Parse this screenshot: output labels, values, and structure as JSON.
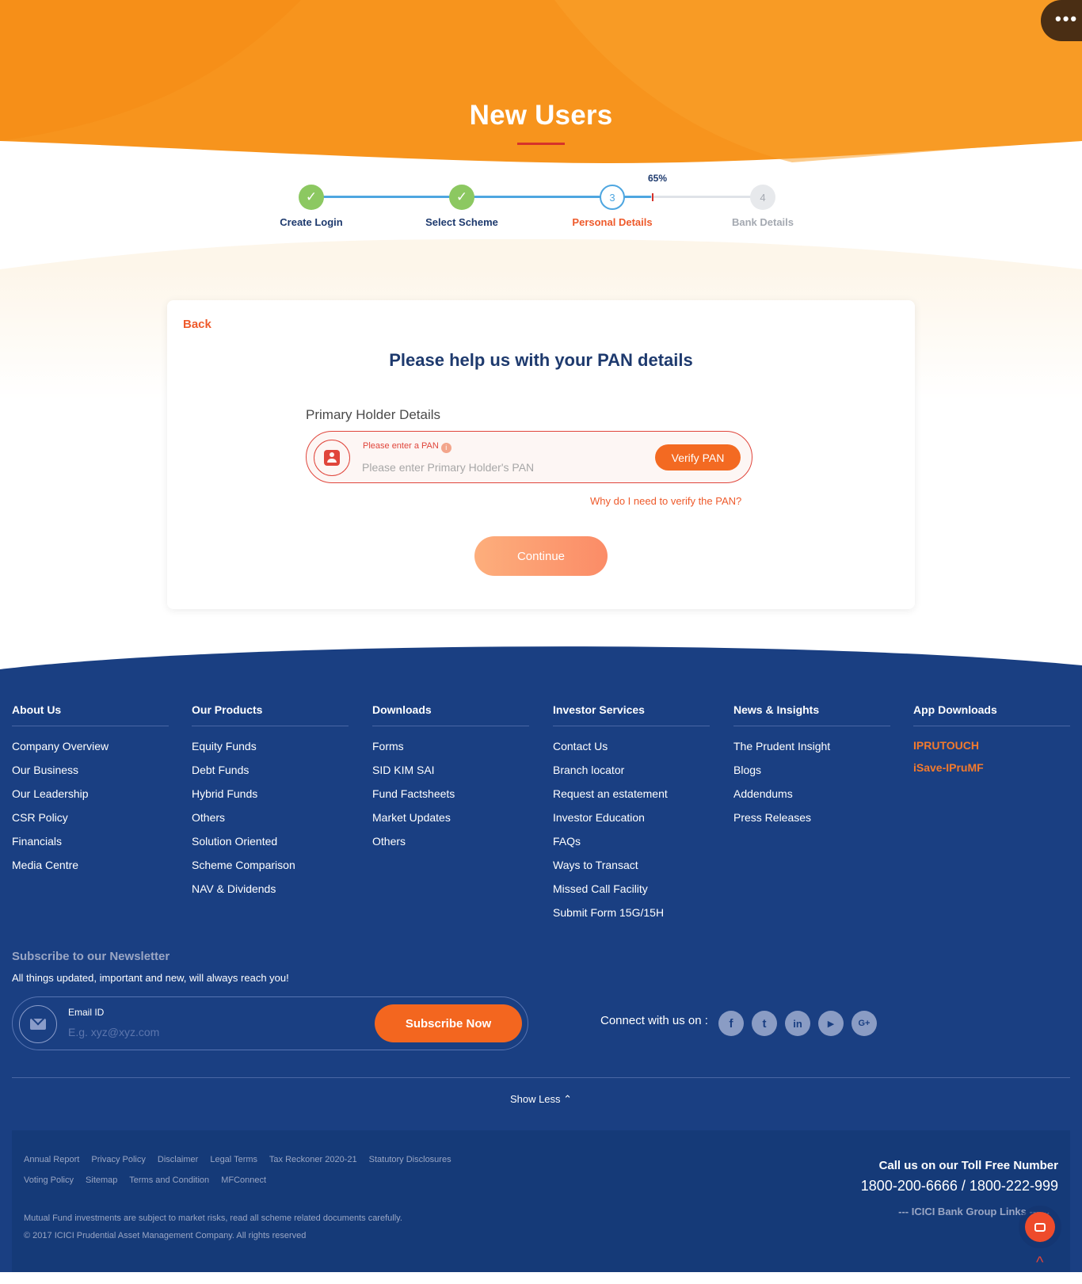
{
  "page": {
    "title": "New Users",
    "menu_icon": "more-dots-icon",
    "menu_glyph": "•••"
  },
  "stepper": {
    "progress_label": "65%",
    "progress_fraction": 0.65,
    "steps": [
      {
        "label": "Create Login",
        "state": "done",
        "glyph": "✓"
      },
      {
        "label": "Select Scheme",
        "state": "done",
        "glyph": "✓"
      },
      {
        "label": "Personal Details",
        "state": "current",
        "glyph": "3"
      },
      {
        "label": "Bank Details",
        "state": "todo",
        "glyph": "4"
      }
    ]
  },
  "card": {
    "back_label": "Back",
    "title": "Please help us with your PAN details",
    "holder_label": "Primary Holder Details",
    "pan_error": "Please enter a PAN",
    "info_glyph": "i",
    "pan_placeholder": "Please enter Primary Holder's PAN",
    "pan_value": "",
    "verify_label": "Verify PAN",
    "why_link": "Why do I need to verify the PAN?",
    "continue_label": "Continue"
  },
  "footer": {
    "columns": [
      {
        "heading": "About Us",
        "links": [
          "Company Overview",
          "Our Business",
          "Our Leadership",
          "CSR Policy",
          "Financials",
          "Media Centre"
        ]
      },
      {
        "heading": "Our Products",
        "links": [
          "Equity Funds",
          "Debt Funds",
          "Hybrid Funds",
          "Others",
          "Solution Oriented",
          "Scheme Comparison",
          "NAV & Dividends"
        ]
      },
      {
        "heading": "Downloads",
        "links": [
          "Forms",
          "SID KIM SAI",
          "Fund Factsheets",
          "Market Updates",
          "Others"
        ]
      },
      {
        "heading": "Investor Services",
        "links": [
          "Contact Us",
          "Branch locator",
          "Request an estatement",
          "Investor Education",
          "FAQs",
          "Ways to Transact",
          "Missed Call Facility",
          "Submit Form 15G/15H"
        ]
      },
      {
        "heading": "News & Insights",
        "links": [
          "The Prudent Insight",
          "Blogs",
          "Addendums",
          "Press Releases"
        ]
      }
    ],
    "app_downloads": {
      "heading": "App Downloads",
      "apps": [
        "IPRUTOUCH",
        "iSave-IPruMF"
      ]
    },
    "newsletter": {
      "title": "Subscribe to our Newsletter",
      "subtitle": "All things updated, important and new, will always reach you!",
      "email_label": "Email ID",
      "email_placeholder": "E.g. xyz@xyz.com",
      "subscribe_label": "Subscribe Now"
    },
    "connect_label": "Connect with us on :",
    "social": [
      {
        "name": "facebook-icon",
        "glyph": "f"
      },
      {
        "name": "twitter-icon",
        "glyph": "t"
      },
      {
        "name": "linkedin-icon",
        "glyph": "in"
      },
      {
        "name": "youtube-icon",
        "glyph": "▶"
      },
      {
        "name": "google-plus-icon",
        "glyph": "G+"
      }
    ],
    "show_less": "Show Less ⌃",
    "legal_row1": [
      "Annual Report",
      "Privacy Policy",
      "Disclaimer",
      "Legal Terms",
      "Tax Reckoner 2020-21",
      "Statutory Disclosures"
    ],
    "legal_row2": [
      "Voting Policy",
      "Sitemap",
      "Terms and Condition",
      "MFConnect"
    ],
    "disclaimer": "Mutual Fund investments are subject to market risks, read all scheme related documents carefully.",
    "copyright": "© 2017 ICICI Prudential Asset Management Company. All rights reserved",
    "toll_title": "Call us on our Toll Free Number",
    "toll_numbers": "1800-200-6666 / 1800-222-999",
    "group_links": "--- ICICI Bank Group Links --- ⌄",
    "scroll_top_glyph": "^"
  },
  "colors": {
    "orange": "#f7941d",
    "navy": "#1a3f82",
    "accent_red": "#e0453b",
    "step_blue": "#4ea6e0",
    "step_green": "#8cc861"
  }
}
